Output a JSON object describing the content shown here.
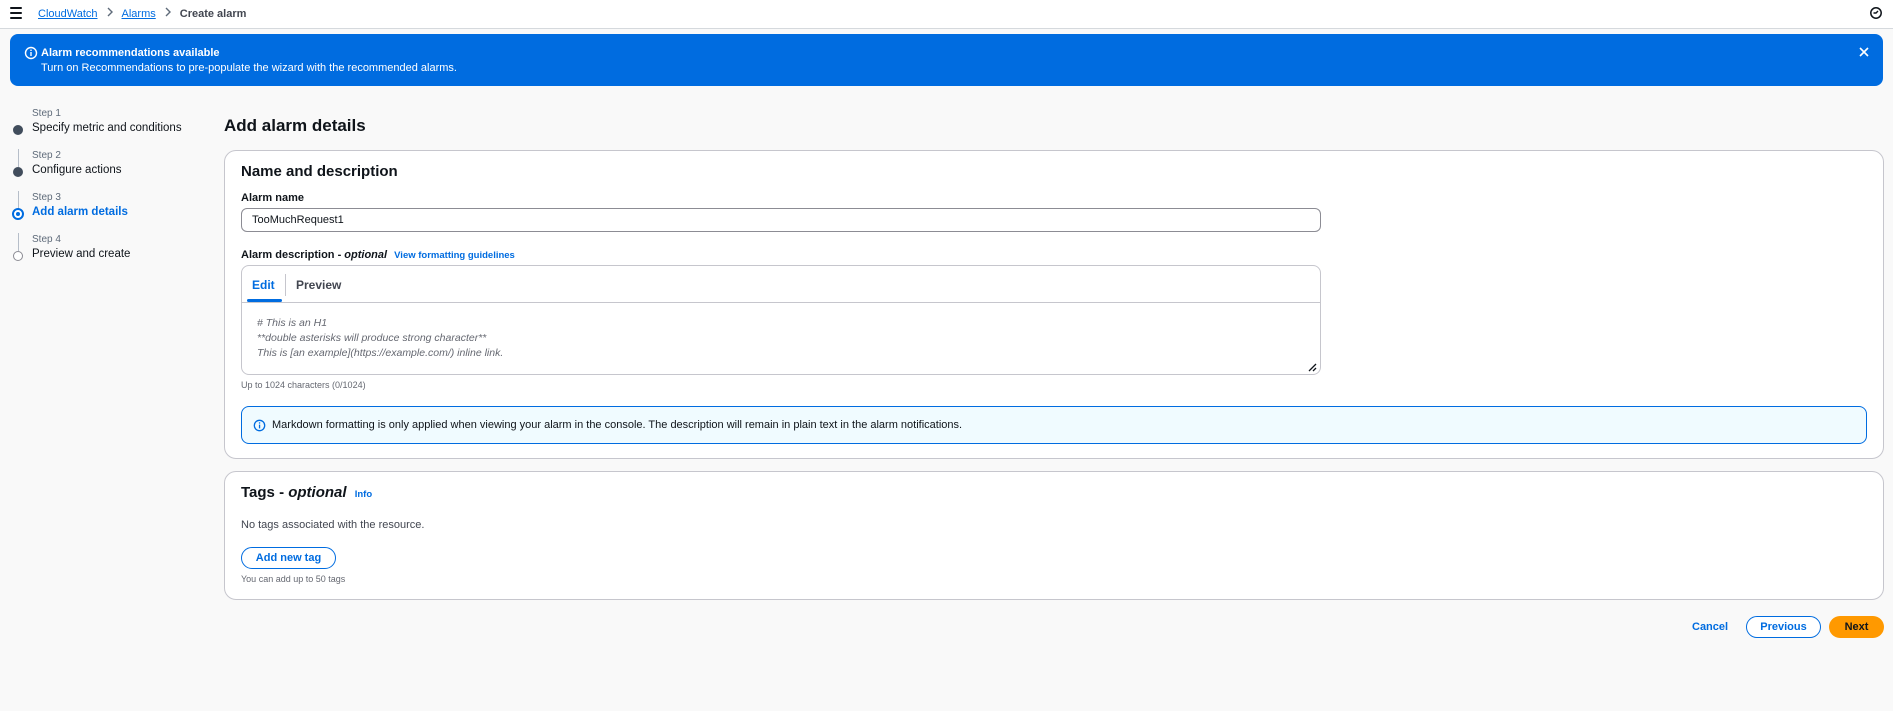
{
  "breadcrumbs": {
    "items": [
      "CloudWatch",
      "Alarms"
    ],
    "current": "Create alarm"
  },
  "flash": {
    "title": "Alarm recommendations available",
    "text": "Turn on Recommendations to pre-populate the wizard with the recommended alarms."
  },
  "steps": [
    {
      "label": "Step 1",
      "title": "Specify metric and conditions",
      "state": "done"
    },
    {
      "label": "Step 2",
      "title": "Configure actions",
      "state": "done"
    },
    {
      "label": "Step 3",
      "title": "Add alarm details",
      "state": "active"
    },
    {
      "label": "Step 4",
      "title": "Preview and create",
      "state": "pending"
    }
  ],
  "page": {
    "title": "Add alarm details"
  },
  "name_section": {
    "title": "Name and description",
    "name_label": "Alarm name",
    "name_value": "TooMuchRequest1",
    "desc_label": "Alarm description - ",
    "desc_optional": "optional",
    "desc_link": "View formatting guidelines",
    "tab_edit": "Edit",
    "tab_preview": "Preview",
    "placeholder_line1": "# This is an H1",
    "placeholder_line2": "**double asterisks will produce strong character**",
    "placeholder_line3": "This is [an example](https://example.com/) inline link.",
    "constraint": "Up to 1024 characters (0/1024)",
    "info_alert": "Markdown formatting is only applied when viewing your alarm in the console. The description will remain in plain text in the alarm notifications."
  },
  "tags_section": {
    "title": "Tags - ",
    "title_optional": "optional",
    "info_link": "Info",
    "empty_text": "No tags associated with the resource.",
    "add_button": "Add new tag",
    "constraint": "You can add up to 50 tags"
  },
  "footer": {
    "cancel": "Cancel",
    "previous": "Previous",
    "next": "Next"
  },
  "colors": {
    "primary": "#006ce0",
    "flash_bg": "#006ce0",
    "next_button": "#ff9900",
    "info_bg": "#f0fbff"
  }
}
